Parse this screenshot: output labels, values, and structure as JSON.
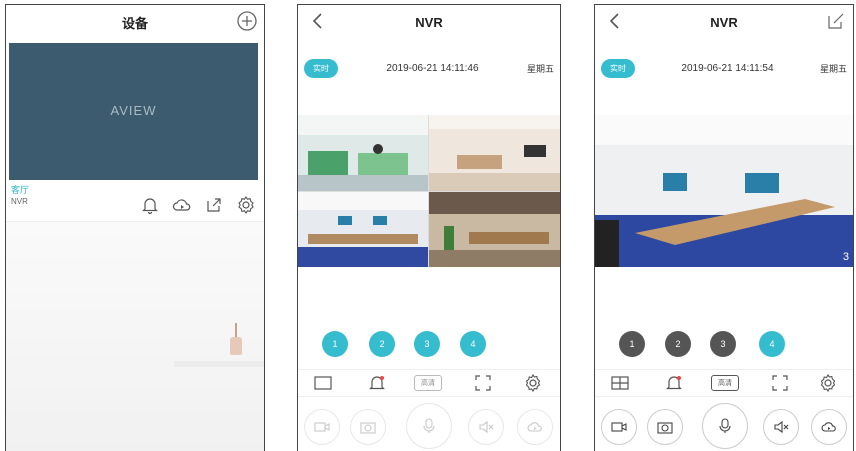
{
  "screen1": {
    "title": "设备",
    "device": {
      "preview_name": "AVIEW",
      "name": "客厅",
      "type": "NVR"
    },
    "icons": [
      "add-circle-icon",
      "bell-icon",
      "cloud-icon",
      "share-icon",
      "gear-icon"
    ]
  },
  "screen2": {
    "title": "NVR",
    "live_label": "实时",
    "datetime": "2019-06-21 14:11:46",
    "weekday": "星期五",
    "channels": [
      "1",
      "2",
      "3",
      "4"
    ],
    "hd_label": "高清"
  },
  "screen3": {
    "title": "NVR",
    "live_label": "实时",
    "datetime": "2019-06-21 14:11:54",
    "weekday": "星期五",
    "channels": [
      "1",
      "2",
      "3",
      "4"
    ],
    "hd_label": "高清",
    "channel_number_overlay": "3"
  },
  "colors": {
    "accent": "#35bccf",
    "card": "#3c5b6e",
    "inactive_channel": "#555555"
  }
}
